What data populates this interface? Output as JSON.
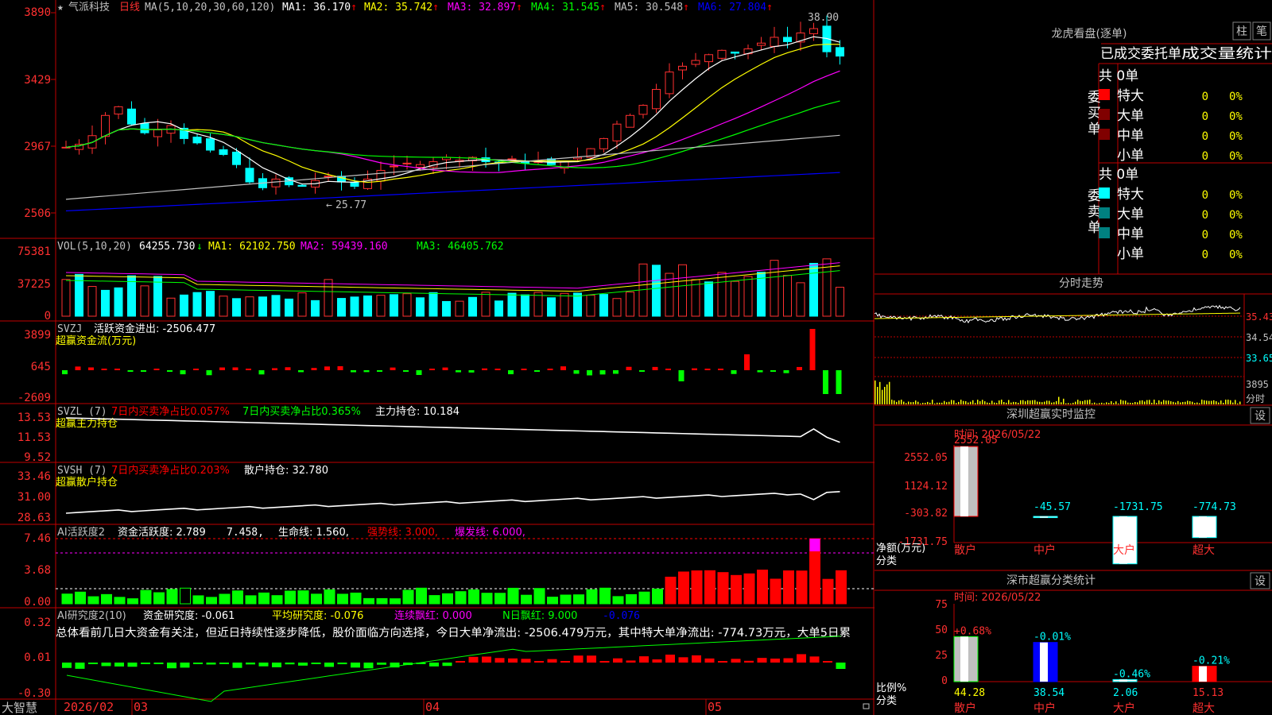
{
  "stock": {
    "name": "气派科技",
    "period": "日线",
    "ma_label": "MA(5,10,20,30,60,120)",
    "ma": [
      {
        "label": "MA1:",
        "value": "36.170",
        "color": "#ffffff"
      },
      {
        "label": "MA2:",
        "value": "35.742",
        "color": "#ffff00"
      },
      {
        "label": "MA3:",
        "value": "32.897",
        "color": "#ff00ff"
      },
      {
        "label": "MA4:",
        "value": "31.545",
        "color": "#00ff00"
      },
      {
        "label": "MA5:",
        "value": "30.548",
        "color": "#c0c0c0"
      },
      {
        "label": "MA6:",
        "value": "27.804",
        "color": "#0000ff"
      }
    ],
    "ma_arrows": [
      "↑",
      "↑",
      "↑",
      "↑",
      "↑",
      "↑"
    ]
  },
  "price_axis": [
    "3890",
    "3429",
    "2967",
    "2506"
  ],
  "price_marks": {
    "high": "38.90",
    "low": "25.77"
  },
  "vol": {
    "label": "VOL(5,10,20)",
    "value": "64255.730",
    "value_arrow": "↓",
    "ma1": "MA1: 62102.750",
    "ma2": "MA2: 59439.160",
    "ma3": "MA3: 46405.762",
    "axis": [
      "75381",
      "37225",
      "0"
    ]
  },
  "svzj": {
    "label": "SVZJ",
    "text": "活跃资金进出: -2506.477",
    "sub": "超赢资金流(万元)",
    "axis": [
      "3899",
      "645",
      "-2609"
    ]
  },
  "svzl": {
    "label": "SVZL (7)",
    "t1": "7日内买卖净占比0.057%",
    "t2": "7日内买卖净占比0.365%",
    "t3": "主力持仓: 10.184",
    "sub": "超赢主力持仓",
    "axis": [
      "13.53",
      "11.53",
      "9.52"
    ]
  },
  "svsh": {
    "label": "SVSH (7)",
    "t1": "7日内买卖净占比0.203%",
    "t3": "散户持仓: 32.780",
    "sub": "超赢散户持仓",
    "axis": [
      "33.46",
      "31.00",
      "28.63"
    ]
  },
  "ai_active": {
    "label": "AI活跃度2",
    "t1": "资金活跃度: 2.789",
    "t2": "7.458,",
    "t3": "生命线: 1.560,",
    "t4": "强势线: 3.000,",
    "t5": "爆发线: 6.000,",
    "axis": [
      "7.46",
      "3.68",
      "0.00"
    ]
  },
  "ai_research": {
    "label": "AI研究度2(10)",
    "t1": "资金研究度: -0.061",
    "t2": "平均研究度: -0.076",
    "t3": "连续飘红: 0.000",
    "t4": "N日飘红: 9.000",
    "t5": "-0.076",
    "summary": "总体看前几日大资金有关注，但近日持续性逐步降低，股价面临方向选择，今日大单净流出: -2506.479万元，其中特大单净流出: -774.73万元，大单5日累",
    "axis": [
      "0.32",
      "0.01",
      "-0.30"
    ]
  },
  "time_axis": {
    "brand": "大智慧",
    "labels": [
      "2026/02",
      "03",
      "04",
      "05"
    ]
  },
  "side": {
    "lhb_title": "龙虎看盘(逐单)",
    "btn_zhu": "柱",
    "btn_bi": "笔",
    "tabs": [
      "已成交",
      "委托单",
      "成交量统计"
    ],
    "buy": {
      "side_label": "委买单",
      "total": "共 0单",
      "rows": [
        {
          "name": "特大",
          "count": "0",
          "pct": "0%",
          "color": "#ff0000"
        },
        {
          "name": "大单",
          "count": "0",
          "pct": "0%",
          "color": "#800000"
        },
        {
          "name": "中单",
          "count": "0",
          "pct": "0%",
          "color": "#800000"
        },
        {
          "name": "小单",
          "count": "0",
          "pct": "0%",
          "color": ""
        }
      ]
    },
    "sell": {
      "side_label": "委卖单",
      "total": "共 0单",
      "rows": [
        {
          "name": "特大",
          "count": "0",
          "pct": "0%",
          "color": "#00ffff"
        },
        {
          "name": "大单",
          "count": "0",
          "pct": "0%",
          "color": "#008080"
        },
        {
          "name": "中单",
          "count": "0",
          "pct": "0%",
          "color": "#008080"
        },
        {
          "name": "小单",
          "count": "0",
          "pct": "0%",
          "color": ""
        }
      ]
    },
    "fs": {
      "title": "分时走势",
      "axis": [
        "35.43",
        "34.54",
        "33.65"
      ],
      "vol_top": "3895",
      "vol_label": "分时"
    },
    "sz": {
      "title": "深圳超赢实时监控",
      "btn": "设",
      "time": "时间: 2026/05/22",
      "axis": [
        "2552.05",
        "1124.12",
        "-303.82",
        "-1731.75"
      ],
      "ylabel": "净额(万元)",
      "xlabel": "分类",
      "cats": [
        "散户",
        "中户",
        "大户",
        "超大"
      ],
      "values": [
        2552.05,
        -45.57,
        -1731.75,
        -774.73
      ],
      "value_labels": [
        "2552.05",
        "-45.57",
        "-1731.75",
        "-774.73"
      ]
    },
    "sc": {
      "title": "深市超赢分类统计",
      "btn": "设",
      "time": "时间: 2026/05/22",
      "axis": [
        "75",
        "50",
        "25",
        "0"
      ],
      "ylabel": "比例%",
      "xlabel": "分类",
      "cats": [
        "散户",
        "中户",
        "大户",
        "超大"
      ],
      "values": [
        44.28,
        38.54,
        2.06,
        15.13
      ],
      "value_labels": [
        "44.28",
        "38.54",
        "2.06",
        "15.13"
      ],
      "changes": [
        "+0.68%",
        "-0.01%",
        "-0.46%",
        "-0.21%"
      ]
    }
  },
  "chart_data": [
    {
      "type": "candlestick",
      "title": "气派科技 日线",
      "ylim": [
        25.06,
        38.9
      ],
      "dates": [
        "2026/02",
        "03",
        "04",
        "05"
      ],
      "high": 38.9,
      "low": 25.77,
      "ma_last": [
        36.17,
        35.742,
        32.897,
        31.545,
        30.548,
        27.804
      ]
    },
    {
      "type": "bar",
      "title": "SZ net by category",
      "categories": [
        "散户",
        "中户",
        "大户",
        "超大"
      ],
      "values": [
        2552.05,
        -45.57,
        -1731.75,
        -774.73
      ]
    },
    {
      "type": "bar",
      "title": "SZ ratio by category",
      "categories": [
        "散户",
        "中户",
        "大户",
        "超大"
      ],
      "values": [
        44.28,
        38.54,
        2.06,
        15.13
      ]
    }
  ]
}
